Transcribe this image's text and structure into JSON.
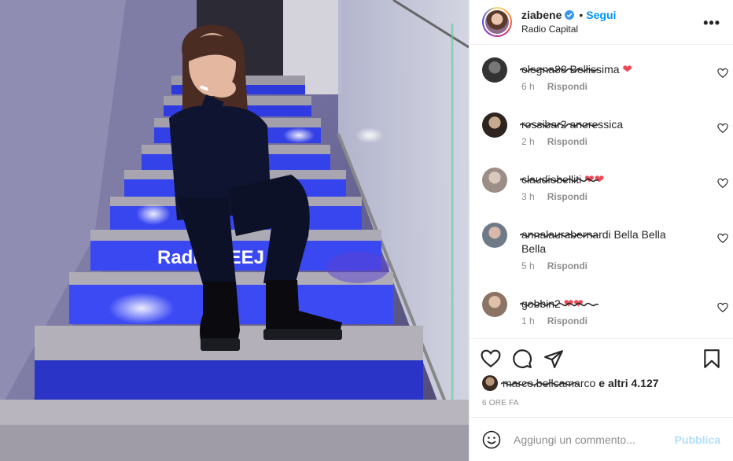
{
  "post": {
    "username": "ziabene",
    "verified": true,
    "dot": "•",
    "follow_label": "Segui",
    "location": "Radio Capital",
    "more_label": "•••",
    "photo_sign_text": "Radio DEEJ"
  },
  "comments": [
    {
      "username": "olegna88",
      "text": "Bellissima",
      "emoji": "❤",
      "time": "6 h",
      "reply_label": "Rispondi"
    },
    {
      "username": "rossibar2",
      "text": "anoressica",
      "emoji": "",
      "time": "2 h",
      "reply_label": "Rispondi"
    },
    {
      "username": "claudiobelliti",
      "text": "",
      "emoji": "❤❤",
      "time": "3 h",
      "reply_label": "Rispondi"
    },
    {
      "username": "annalaurabernardi",
      "text": "Bella Bella Bella",
      "emoji": "",
      "time": "5 h",
      "reply_label": "Rispondi"
    },
    {
      "username": "gobbin2",
      "text": "",
      "emoji": "❤❤",
      "time": "1 h",
      "reply_label": "Rispondi"
    }
  ],
  "likes": {
    "liked_by": "marco.bellcamarco",
    "rest": "e altri 4.127"
  },
  "time_ago": "6 ORE FA",
  "add_comment": {
    "placeholder": "Aggiungi un commento...",
    "publish_label": "Pubblica"
  },
  "icons": {
    "like": "heart-icon",
    "comment": "comment-icon",
    "share": "paper-plane-icon",
    "save": "bookmark-icon",
    "emoji": "emoji-icon",
    "more": "more-icon"
  },
  "colors": {
    "accent": "#0095f6",
    "publish_disabled": "#b2dffc",
    "heart_red": "#ed4956",
    "meta_gray": "#8e8e8e"
  }
}
